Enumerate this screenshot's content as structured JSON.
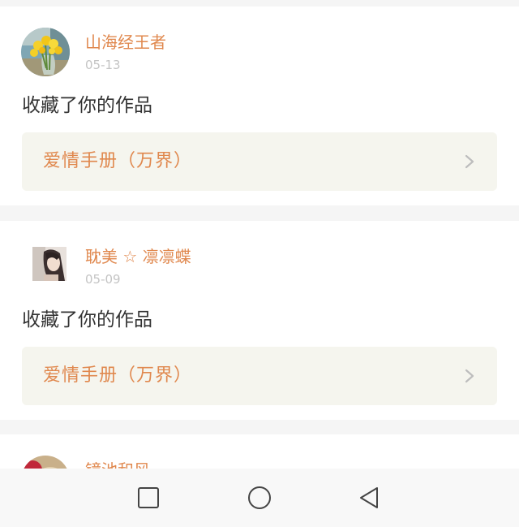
{
  "notifications": [
    {
      "user_name": "山海经王者",
      "date": "05-13",
      "action": "收藏了你的作品",
      "work_title": "爱情手册（万界）",
      "avatar": "flower-vase-avatar"
    },
    {
      "user_name": "耽美 ☆ 凛凛蝶",
      "date": "05-09",
      "action": "收藏了你的作品",
      "work_title": "爱情手册（万界）",
      "avatar": "girl-portrait-avatar"
    },
    {
      "user_name": "镜池和风",
      "avatar": "animal-avatar"
    }
  ],
  "navbar": {
    "recent_icon": "square-icon",
    "home_icon": "circle-icon",
    "back_icon": "triangle-back-icon"
  },
  "colors": {
    "accent": "#e0884e",
    "date": "#c4c4c4",
    "text": "#333333",
    "work_bg": "#f5f5ee",
    "page_bg": "#f5f5f5"
  }
}
